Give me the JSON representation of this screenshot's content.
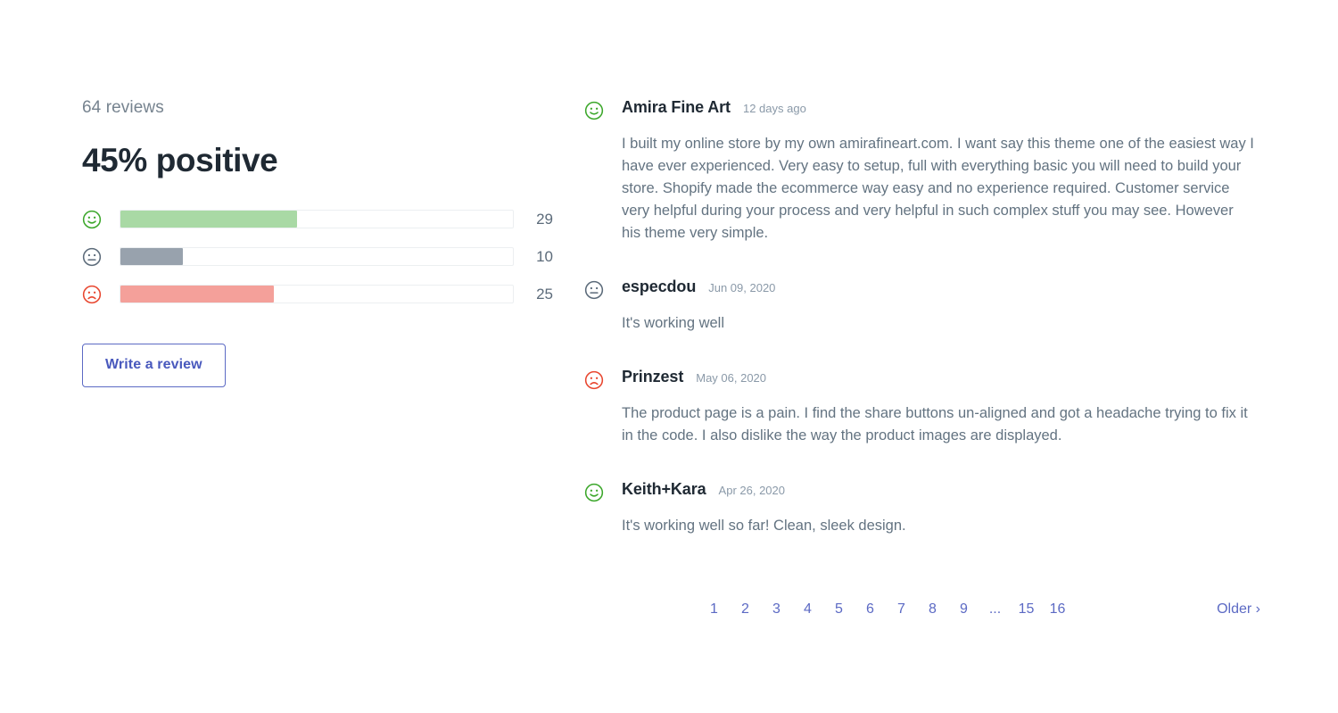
{
  "summary": {
    "review_count_label": "64 reviews",
    "positive_headline": "45% positive",
    "write_review_label": "Write a review",
    "accent_color": "#5c6ac4",
    "bars": [
      {
        "sentiment": "positive",
        "icon": "happy-face-icon",
        "value": "29",
        "percent": 45,
        "fill_color": "#a9d9a5",
        "icon_color": "#3ca72b"
      },
      {
        "sentiment": "neutral",
        "icon": "neutral-face-icon",
        "value": "10",
        "percent": 16,
        "fill_color": "#98a2ad",
        "icon_color": "#5c6b7a"
      },
      {
        "sentiment": "negative",
        "icon": "sad-face-icon",
        "value": "25",
        "percent": 39,
        "fill_color": "#f4a09a",
        "icon_color": "#e8462f"
      }
    ]
  },
  "chart_data": {
    "type": "bar",
    "title": "45% positive",
    "subtitle": "64 reviews",
    "categories": [
      "positive",
      "neutral",
      "negative"
    ],
    "values": [
      29,
      10,
      25
    ],
    "percentages": [
      45,
      16,
      39
    ],
    "total": 64,
    "xlabel": "",
    "ylabel": "",
    "xlim": [
      0,
      64
    ],
    "grid": false,
    "orientation": "horizontal",
    "colors": [
      "#a9d9a5",
      "#98a2ad",
      "#f4a09a"
    ],
    "value_labels": [
      "29",
      "10",
      "25"
    ]
  },
  "reviews": [
    {
      "icon": "happy-face-icon",
      "icon_color": "#3ca72b",
      "author": "Amira Fine Art",
      "date": "12 days ago",
      "body": "I built my online store by my own amirafineart.com. I want say this theme one of the easiest way I have ever experienced. Very easy to setup, full with everything basic you will need to build your store. Shopify made the ecommerce way easy and no experience required. Customer service very helpful during your process and very helpful in such complex stuff you may see. However his theme very simple."
    },
    {
      "icon": "neutral-face-icon",
      "icon_color": "#5c6b7a",
      "author": "especdou",
      "date": "Jun 09, 2020",
      "body": "It's working well"
    },
    {
      "icon": "sad-face-icon",
      "icon_color": "#e8462f",
      "author": "Prinzest",
      "date": "May 06, 2020",
      "body": "The product page is a pain. I find the share buttons un-aligned and got a headache trying to fix it in the code. I also dislike the way the product images are displayed."
    },
    {
      "icon": "happy-face-icon",
      "icon_color": "#3ca72b",
      "author": "Keith+Kara",
      "date": "Apr 26, 2020",
      "body": "It's working well so far! Clean, sleek design."
    }
  ],
  "pagination": {
    "pages": [
      "1",
      "2",
      "3",
      "4",
      "5",
      "6",
      "7",
      "8",
      "9"
    ],
    "ellipsis": "...",
    "tail_pages": [
      "15",
      "16"
    ],
    "older_label": "Older ›"
  }
}
